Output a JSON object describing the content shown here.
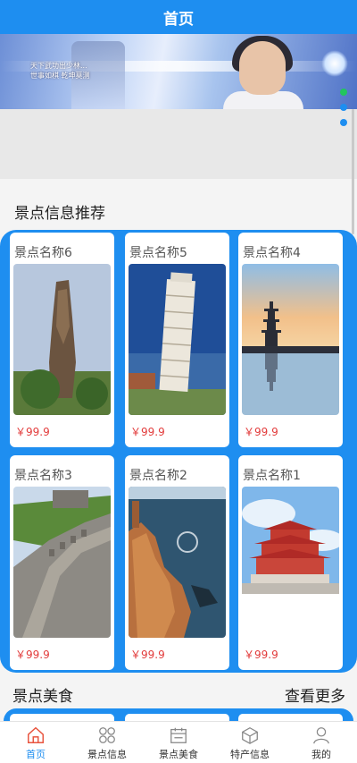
{
  "header": {
    "title": "首页"
  },
  "banner": {
    "poem_lines": [
      "天下武功出少林...",
      "世事如棋 乾坤莫测"
    ]
  },
  "sections": {
    "recommend_title": "景点信息推荐",
    "food_title": "景点美食",
    "more_label": "查看更多"
  },
  "spots": [
    {
      "name": "景点名称6",
      "price": "￥99.9",
      "image": "stone-pillar"
    },
    {
      "name": "景点名称5",
      "price": "￥99.9",
      "image": "leaning-tower"
    },
    {
      "name": "景点名称4",
      "price": "￥99.9",
      "image": "pagoda-lake"
    },
    {
      "name": "景点名称3",
      "price": "￥99.9",
      "image": "great-wall"
    },
    {
      "name": "景点名称2",
      "price": "￥99.9",
      "image": "coastal-rock"
    },
    {
      "name": "景点名称1",
      "price": "￥99.9",
      "image": "red-pavilion"
    }
  ],
  "nav": [
    {
      "label": "首页",
      "icon": "home-icon",
      "active": true
    },
    {
      "label": "景点信息",
      "icon": "grid-icon",
      "active": false
    },
    {
      "label": "景点美食",
      "icon": "calendar-icon",
      "active": false
    },
    {
      "label": "特产信息",
      "icon": "box-icon",
      "active": false
    },
    {
      "label": "我的",
      "icon": "user-icon",
      "active": false
    }
  ],
  "colors": {
    "primary": "#1e8ef0",
    "price": "#e23b3b",
    "dot_active": "#22c55e"
  }
}
